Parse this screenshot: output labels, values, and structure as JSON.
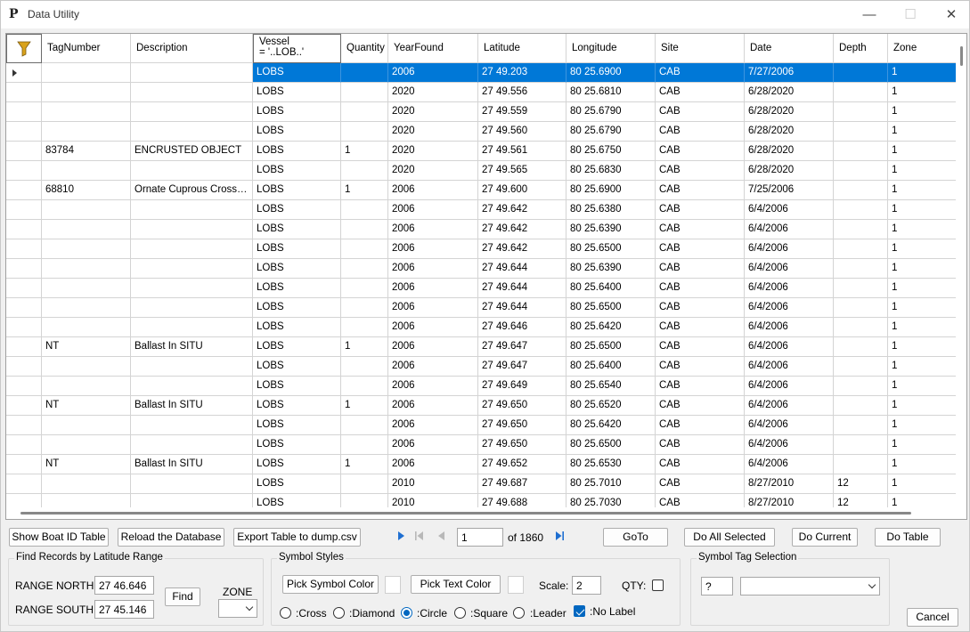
{
  "window": {
    "title": "Data Utility",
    "icon": "P",
    "controls": {
      "minimize": "—",
      "maximize": "☐",
      "close": "✕"
    }
  },
  "grid": {
    "columns": [
      {
        "key": "tag",
        "label": "TagNumber"
      },
      {
        "key": "desc",
        "label": "Description"
      },
      {
        "key": "vessel",
        "label": "Vessel",
        "filter": "= '..LOB..'"
      },
      {
        "key": "qty",
        "label": "Quantity"
      },
      {
        "key": "year",
        "label": "YearFound"
      },
      {
        "key": "lat",
        "label": "Latitude"
      },
      {
        "key": "lon",
        "label": "Longitude"
      },
      {
        "key": "site",
        "label": "Site"
      },
      {
        "key": "date",
        "label": "Date"
      },
      {
        "key": "depth",
        "label": "Depth"
      },
      {
        "key": "zone",
        "label": "Zone"
      }
    ],
    "selected_row": 0,
    "rows": [
      [
        "",
        "",
        "LOBS",
        "",
        "2006",
        "27 49.203",
        "80 25.6900",
        "CAB",
        "7/27/2006",
        "",
        "1"
      ],
      [
        "",
        "",
        "LOBS",
        "",
        "2020",
        "27 49.556",
        "80 25.6810",
        "CAB",
        "6/28/2020",
        "",
        "1"
      ],
      [
        "",
        "",
        "LOBS",
        "",
        "2020",
        "27 49.559",
        "80 25.6790",
        "CAB",
        "6/28/2020",
        "",
        "1"
      ],
      [
        "",
        "",
        "LOBS",
        "",
        "2020",
        "27 49.560",
        "80 25.6790",
        "CAB",
        "6/28/2020",
        "",
        "1"
      ],
      [
        "83784",
        "ENCRUSTED OBJECT",
        "LOBS",
        "1",
        "2020",
        "27 49.561",
        "80 25.6750",
        "CAB",
        "6/28/2020",
        "",
        "1"
      ],
      [
        "",
        "",
        "LOBS",
        "",
        "2020",
        "27 49.565",
        "80 25.6830",
        "CAB",
        "6/28/2020",
        "",
        "1"
      ],
      [
        "68810",
        "Ornate Cuprous Crosswit...",
        "LOBS",
        "1",
        "2006",
        "27 49.600",
        "80 25.6900",
        "CAB",
        "7/25/2006",
        "",
        "1"
      ],
      [
        "",
        "",
        "LOBS",
        "",
        "2006",
        "27 49.642",
        "80 25.6380",
        "CAB",
        "6/4/2006",
        "",
        "1"
      ],
      [
        "",
        "",
        "LOBS",
        "",
        "2006",
        "27 49.642",
        "80 25.6390",
        "CAB",
        "6/4/2006",
        "",
        "1"
      ],
      [
        "",
        "",
        "LOBS",
        "",
        "2006",
        "27 49.642",
        "80 25.6500",
        "CAB",
        "6/4/2006",
        "",
        "1"
      ],
      [
        "",
        "",
        "LOBS",
        "",
        "2006",
        "27 49.644",
        "80 25.6390",
        "CAB",
        "6/4/2006",
        "",
        "1"
      ],
      [
        "",
        "",
        "LOBS",
        "",
        "2006",
        "27 49.644",
        "80 25.6400",
        "CAB",
        "6/4/2006",
        "",
        "1"
      ],
      [
        "",
        "",
        "LOBS",
        "",
        "2006",
        "27 49.644",
        "80 25.6500",
        "CAB",
        "6/4/2006",
        "",
        "1"
      ],
      [
        "",
        "",
        "LOBS",
        "",
        "2006",
        "27 49.646",
        "80 25.6420",
        "CAB",
        "6/4/2006",
        "",
        "1"
      ],
      [
        "NT",
        "Ballast In SITU",
        "LOBS",
        "1",
        "2006",
        "27 49.647",
        "80 25.6500",
        "CAB",
        "6/4/2006",
        "",
        "1"
      ],
      [
        "",
        "",
        "LOBS",
        "",
        "2006",
        "27 49.647",
        "80 25.6400",
        "CAB",
        "6/4/2006",
        "",
        "1"
      ],
      [
        "",
        "",
        "LOBS",
        "",
        "2006",
        "27 49.649",
        "80 25.6540",
        "CAB",
        "6/4/2006",
        "",
        "1"
      ],
      [
        "NT",
        "Ballast In SITU",
        "LOBS",
        "1",
        "2006",
        "27 49.650",
        "80 25.6520",
        "CAB",
        "6/4/2006",
        "",
        "1"
      ],
      [
        "",
        "",
        "LOBS",
        "",
        "2006",
        "27 49.650",
        "80 25.6420",
        "CAB",
        "6/4/2006",
        "",
        "1"
      ],
      [
        "",
        "",
        "LOBS",
        "",
        "2006",
        "27 49.650",
        "80 25.6500",
        "CAB",
        "6/4/2006",
        "",
        "1"
      ],
      [
        "NT",
        "Ballast In SITU",
        "LOBS",
        "1",
        "2006",
        "27 49.652",
        "80 25.6530",
        "CAB",
        "6/4/2006",
        "",
        "1"
      ],
      [
        "",
        "",
        "LOBS",
        "",
        "2010",
        "27 49.687",
        "80 25.7010",
        "CAB",
        "8/27/2010",
        "12",
        "1"
      ],
      [
        "",
        "",
        "LOBS",
        "",
        "2010",
        "27 49.688",
        "80 25.7030",
        "CAB",
        "8/27/2010",
        "12",
        "1"
      ]
    ]
  },
  "toolbar": {
    "show_boat_id": "Show Boat ID Table",
    "reload_db": "Reload the Database",
    "export_table": "Export Table to dump.csv",
    "goto": "GoTo",
    "do_all_selected": "Do All Selected",
    "do_current": "Do Current",
    "do_table": "Do Table"
  },
  "pager": {
    "current": "1",
    "of_label": "of 1860"
  },
  "find_records": {
    "title": "Find Records by Latitude Range",
    "north_label": "RANGE NORTH:",
    "north_value": "27 46.646",
    "south_label": "RANGE SOUTH:",
    "south_value": "27 45.146",
    "find_button": "Find",
    "zone_label": "ZONE",
    "zone_value": ""
  },
  "symbol_styles": {
    "title": "Symbol Styles",
    "pick_symbol_color": "Pick Symbol Color",
    "pick_text_color": "Pick Text Color",
    "scale_label": "Scale:",
    "scale_value": "2",
    "qty_label": "QTY:",
    "qty_checked": false,
    "shapes": [
      {
        "label": ":Cross",
        "checked": false
      },
      {
        "label": ":Diamond",
        "checked": false
      },
      {
        "label": ":Circle",
        "checked": true
      },
      {
        "label": ":Square",
        "checked": false
      },
      {
        "label": ":Leader",
        "checked": false
      }
    ],
    "no_label": {
      "label": ":No Label",
      "checked": true
    }
  },
  "symbol_tag": {
    "title": "Symbol Tag Selection",
    "tag_value": "?",
    "selection": ""
  },
  "cancel_button": "Cancel"
}
